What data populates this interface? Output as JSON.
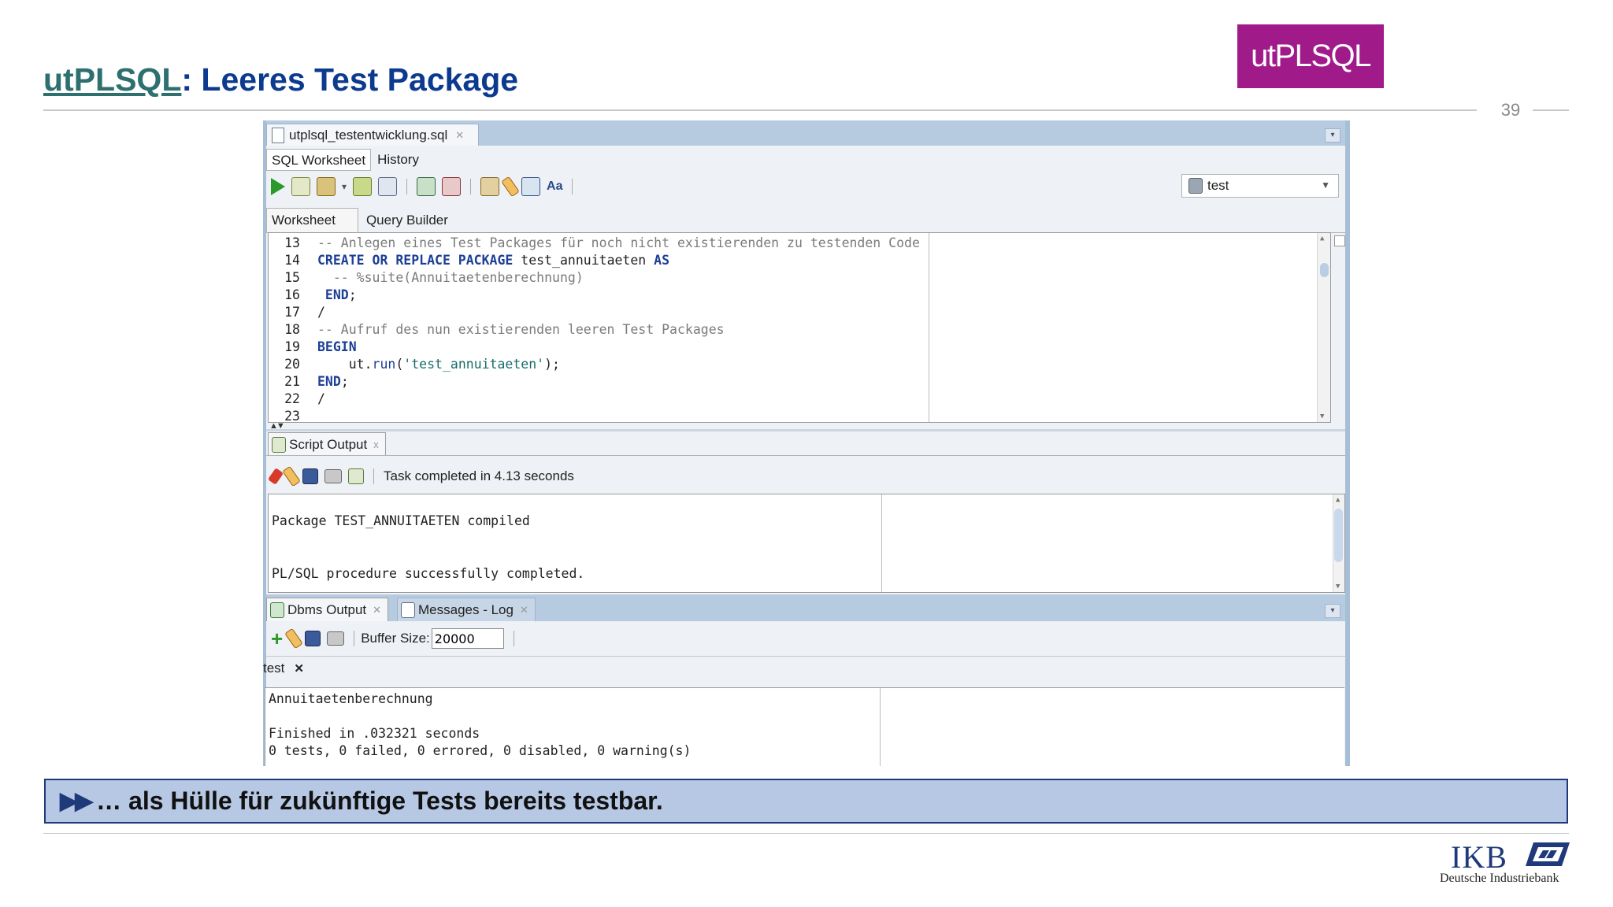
{
  "slide": {
    "title_link": "utPLSQL",
    "title_rest": ": Leeres Test Package",
    "page_number": "39",
    "logo_text": "utPLSQL",
    "callout": "… als Hülle für zukünftige Tests bereits testbar.",
    "footer_brand": "IKB",
    "footer_sub": "Deutsche Industriebank"
  },
  "ide": {
    "file_tab": "utplsql_testentwicklung.sql",
    "tabs": [
      "SQL Worksheet",
      "History"
    ],
    "connection": "test",
    "inner_tabs": [
      "Worksheet",
      "Query Builder"
    ],
    "code_lines": [
      {
        "n": "13",
        "parts": [
          {
            "t": "-- Anlegen eines Test Packages für noch nicht existierenden zu testenden Code",
            "c": "cm"
          }
        ]
      },
      {
        "n": "14",
        "parts": [
          {
            "t": "CREATE OR REPLACE PACKAGE",
            "c": "kw"
          },
          {
            "t": " test_annuitaeten ",
            "c": ""
          },
          {
            "t": "AS",
            "c": "kw"
          }
        ]
      },
      {
        "n": "15",
        "parts": [
          {
            "t": "  -- %suite(Annuitaetenberechnung)",
            "c": "cm"
          }
        ]
      },
      {
        "n": "16",
        "parts": [
          {
            "t": " END",
            "c": "kw"
          },
          {
            "t": ";",
            "c": ""
          }
        ]
      },
      {
        "n": "17",
        "parts": [
          {
            "t": "/",
            "c": ""
          }
        ]
      },
      {
        "n": "18",
        "parts": [
          {
            "t": "-- Aufruf des nun existierenden leeren Test Packages",
            "c": "cm"
          }
        ]
      },
      {
        "n": "19",
        "parts": [
          {
            "t": "BEGIN",
            "c": "kw"
          }
        ]
      },
      {
        "n": "20",
        "parts": [
          {
            "t": "    ut.",
            "c": ""
          },
          {
            "t": "run",
            "c": "fn"
          },
          {
            "t": "(",
            "c": ""
          },
          {
            "t": "'test_annuitaeten'",
            "c": "str"
          },
          {
            "t": ");",
            "c": ""
          }
        ]
      },
      {
        "n": "21",
        "parts": [
          {
            "t": "END",
            "c": "kw"
          },
          {
            "t": ";",
            "c": ""
          }
        ]
      },
      {
        "n": "22",
        "parts": [
          {
            "t": "/",
            "c": ""
          }
        ]
      }
    ],
    "script_output": {
      "tab": "Script Output",
      "status": "Task completed in 4.13 seconds",
      "lines": [
        "Package TEST_ANNUITAETEN compiled",
        "PL/SQL procedure successfully completed."
      ]
    },
    "dbms_output": {
      "tab": "Dbms Output",
      "messages_tab": "Messages - Log",
      "buffer_label": "Buffer Size:",
      "buffer_value": "20000",
      "connection_tab": "test",
      "lines": [
        "Annuitaetenberechnung",
        "Finished in .032321 seconds",
        "0 tests, 0 failed, 0 errored, 0 disabled, 0 warning(s)"
      ]
    }
  },
  "colors": {
    "title": "#0b3a8e",
    "title_link": "#2e6f6f",
    "logo_bg": "#a11a8a",
    "callout_bg": "#b6c8e4",
    "keyword": "#1c3f96"
  },
  "icons": [
    "run-icon",
    "run-script-icon",
    "autotrace-icon",
    "explain-plan-icon",
    "commit-icon",
    "rollback-icon",
    "sql-tuning-icon",
    "clear-icon",
    "history-icon",
    "format-icon",
    "pin-icon",
    "save-icon",
    "print-icon",
    "add-icon"
  ]
}
